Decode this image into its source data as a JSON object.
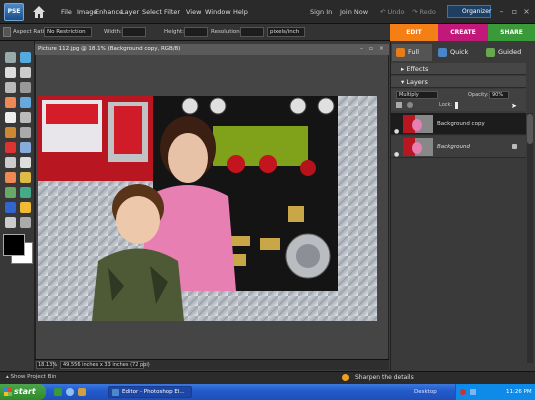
{
  "app": {
    "logo": "PSE"
  },
  "menu": {
    "items": [
      "File",
      "Image",
      "Enhance",
      "Layer",
      "Select",
      "Filter",
      "View",
      "Window",
      "Help"
    ]
  },
  "topbar": {
    "sign_in": "Sign In",
    "join_now": "Join Now",
    "undo": "Undo",
    "redo": "Redo",
    "organizer": "Organizer"
  },
  "options": {
    "aspect_label": "Aspect Ratio:",
    "aspect_value": "No Restriction",
    "width_label": "Width:",
    "height_label": "Height:",
    "resolution_label": "Resolution:",
    "resolution_unit": "pixels/inch"
  },
  "modes": {
    "edit": "EDIT",
    "create": "CREATE",
    "share": "SHARE"
  },
  "subtabs": {
    "full": "Full",
    "quick": "Quick",
    "guided": "Guided"
  },
  "panels": {
    "effects": "Effects",
    "layers": "Layers"
  },
  "layers_ctl": {
    "blend_mode": "Multiply",
    "opacity_label": "Opacity:",
    "opacity_value": "90%",
    "lock_label": "Lock:"
  },
  "layers": [
    {
      "name": "Background copy"
    },
    {
      "name": "Background"
    }
  ],
  "document": {
    "title": "Picture 112.jpg @ 18.1% (Background copy, RGB/8)",
    "zoom": "18.13%",
    "info": "49.556 inches x 33 inches (72 ppi)"
  },
  "status": {
    "project_bin": "Show Project Bin",
    "hint": "Sharpen the details"
  },
  "taskbar": {
    "start": "start",
    "task": "Editor - Photoshop El...",
    "desktop": "Desktop",
    "time": "11:26 PM"
  },
  "colors": {
    "edit_tab": "#f57f17",
    "create_tab": "#c2187a",
    "share_tab": "#3a9a3a",
    "selected_layer": "#1c1c1c"
  }
}
